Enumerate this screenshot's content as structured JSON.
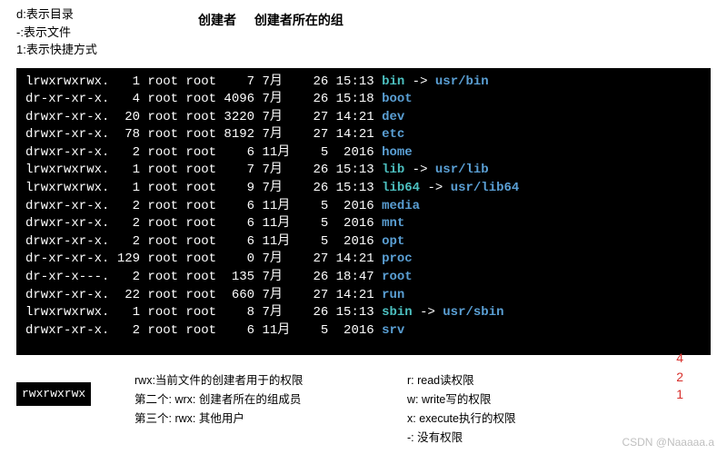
{
  "top_left": {
    "l1": "d:表示目录",
    "l2": "-:表示文件",
    "l3": "1:表示快捷方式"
  },
  "top_mid": {
    "c1": "创建者",
    "c2": "创建者所在的组"
  },
  "listing": [
    {
      "perm": "lrwxrwxrwx.",
      "links": "1",
      "owner": "root",
      "group": "root",
      "size": "7",
      "mon": "7月",
      "day": "26",
      "time": "15:13",
      "name": "bin",
      "link": "usr/bin",
      "cls": "cyan"
    },
    {
      "perm": "dr-xr-xr-x.",
      "links": "4",
      "owner": "root",
      "group": "root",
      "size": "4096",
      "mon": "7月",
      "day": "26",
      "time": "15:18",
      "name": "boot",
      "cls": "blue"
    },
    {
      "perm": "drwxr-xr-x.",
      "links": "20",
      "owner": "root",
      "group": "root",
      "size": "3220",
      "mon": "7月",
      "day": "27",
      "time": "14:21",
      "name": "dev",
      "cls": "blue"
    },
    {
      "perm": "drwxr-xr-x.",
      "links": "78",
      "owner": "root",
      "group": "root",
      "size": "8192",
      "mon": "7月",
      "day": "27",
      "time": "14:21",
      "name": "etc",
      "cls": "blue"
    },
    {
      "perm": "drwxr-xr-x.",
      "links": "2",
      "owner": "root",
      "group": "root",
      "size": "6",
      "mon": "11月",
      "day": "5",
      "time": "2016",
      "name": "home",
      "cls": "blue"
    },
    {
      "perm": "lrwxrwxrwx.",
      "links": "1",
      "owner": "root",
      "group": "root",
      "size": "7",
      "mon": "7月",
      "day": "26",
      "time": "15:13",
      "name": "lib",
      "link": "usr/lib",
      "cls": "cyan"
    },
    {
      "perm": "lrwxrwxrwx.",
      "links": "1",
      "owner": "root",
      "group": "root",
      "size": "9",
      "mon": "7月",
      "day": "26",
      "time": "15:13",
      "name": "lib64",
      "link": "usr/lib64",
      "cls": "cyan"
    },
    {
      "perm": "drwxr-xr-x.",
      "links": "2",
      "owner": "root",
      "group": "root",
      "size": "6",
      "mon": "11月",
      "day": "5",
      "time": "2016",
      "name": "media",
      "cls": "blue"
    },
    {
      "perm": "drwxr-xr-x.",
      "links": "2",
      "owner": "root",
      "group": "root",
      "size": "6",
      "mon": "11月",
      "day": "5",
      "time": "2016",
      "name": "mnt",
      "cls": "blue"
    },
    {
      "perm": "drwxr-xr-x.",
      "links": "2",
      "owner": "root",
      "group": "root",
      "size": "6",
      "mon": "11月",
      "day": "5",
      "time": "2016",
      "name": "opt",
      "cls": "blue"
    },
    {
      "perm": "dr-xr-xr-x.",
      "links": "129",
      "owner": "root",
      "group": "root",
      "size": "0",
      "mon": "7月",
      "day": "27",
      "time": "14:21",
      "name": "proc",
      "cls": "blue"
    },
    {
      "perm": "dr-xr-x---.",
      "links": "2",
      "owner": "root",
      "group": "root",
      "size": "135",
      "mon": "7月",
      "day": "26",
      "time": "18:47",
      "name": "root",
      "cls": "blue"
    },
    {
      "perm": "drwxr-xr-x.",
      "links": "22",
      "owner": "root",
      "group": "root",
      "size": "660",
      "mon": "7月",
      "day": "27",
      "time": "14:21",
      "name": "run",
      "cls": "blue"
    },
    {
      "perm": "lrwxrwxrwx.",
      "links": "1",
      "owner": "root",
      "group": "root",
      "size": "8",
      "mon": "7月",
      "day": "26",
      "time": "15:13",
      "name": "sbin",
      "link": "usr/sbin",
      "cls": "cyan"
    },
    {
      "perm": "drwxr-xr-x.",
      "links": "2",
      "owner": "root",
      "group": "root",
      "size": "6",
      "mon": "11月",
      "day": "5",
      "time": "2016",
      "name": "srv",
      "cls": "blue"
    }
  ],
  "badge": "rwxrwxrwx",
  "legend_left": {
    "l1": "rwx:当前文件的创建者用于的权限",
    "l2": "第二个: wrx: 创建者所在的组成员",
    "l3": "第三个: rwx: 其他用户"
  },
  "legend_right": {
    "l1": "r: read读权限",
    "l2": "w: write写的权限",
    "l3": "x: execute执行的权限",
    "l4": "-: 没有权限"
  },
  "red": {
    "n4": "4",
    "n2": "2",
    "n1": "1"
  },
  "watermark": "CSDN @Naaaaa.a"
}
